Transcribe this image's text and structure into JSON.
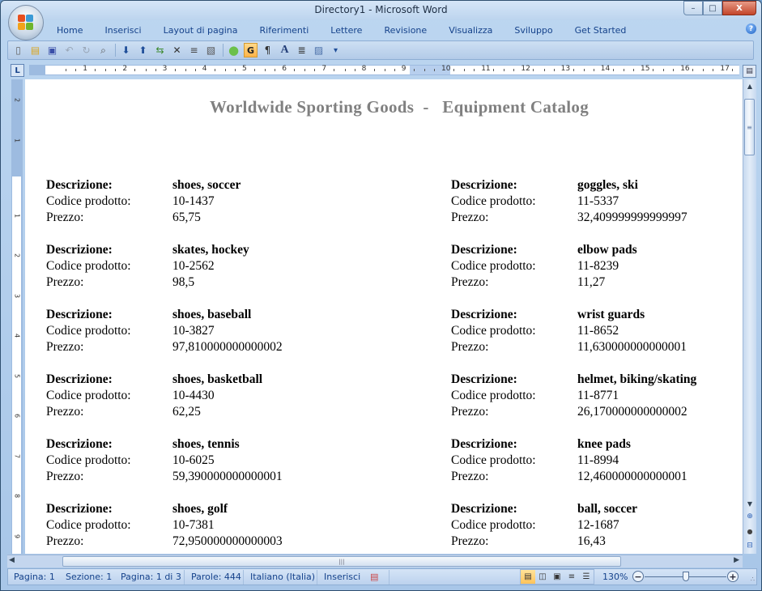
{
  "window": {
    "title": "Directory1 - Microsoft Word",
    "controls": {
      "minimize": "–",
      "maximize": "□",
      "close": "X"
    }
  },
  "ribbon": {
    "tabs": [
      "Home",
      "Inserisci",
      "Layout di pagina",
      "Riferimenti",
      "Lettere",
      "Revisione",
      "Visualizza",
      "Sviluppo",
      "Get Started"
    ],
    "help": "?"
  },
  "toolbar": {
    "items": [
      {
        "icon": "new-document-icon",
        "glyph": "▯"
      },
      {
        "icon": "open-folder-icon",
        "glyph": "▤"
      },
      {
        "icon": "save-icon",
        "glyph": "▣"
      },
      {
        "icon": "undo-icon",
        "glyph": "↶"
      },
      {
        "icon": "redo-icon",
        "glyph": "↻"
      },
      {
        "icon": "print-preview-icon",
        "glyph": "⌕"
      },
      {
        "icon": "move-down-icon",
        "glyph": "⬇"
      },
      {
        "icon": "move-up-icon",
        "glyph": "⬆"
      },
      {
        "icon": "merge-fields-icon",
        "glyph": "⇆"
      },
      {
        "icon": "delete-icon",
        "glyph": "✕"
      },
      {
        "icon": "align-text-icon",
        "glyph": "≡"
      },
      {
        "icon": "document-icon",
        "glyph": "▧"
      },
      {
        "icon": "green-circle-icon",
        "glyph": "●"
      },
      {
        "icon": "g-button-icon",
        "glyph": "G"
      },
      {
        "icon": "pilcrow-icon",
        "glyph": "¶"
      },
      {
        "icon": "font-a-icon",
        "glyph": "A"
      },
      {
        "icon": "paragraph-format-icon",
        "glyph": "≣"
      },
      {
        "icon": "database-icon",
        "glyph": "▨"
      },
      {
        "icon": "customize-toolbar-icon",
        "glyph": "▾"
      }
    ]
  },
  "ruler": {
    "corner": "L",
    "h_numbers": [
      "1",
      "2",
      "3",
      "4",
      "5",
      "6",
      "7",
      "8",
      "9",
      "10",
      "11",
      "12",
      "13",
      "14",
      "15",
      "16",
      "17"
    ],
    "v_numbers_top": [
      "2",
      "1"
    ],
    "v_numbers": [
      "1",
      "2",
      "3",
      "4",
      "5",
      "6",
      "7",
      "8",
      "9"
    ]
  },
  "document": {
    "title": "Worldwide Sporting Goods  -   Equipment Catalog",
    "labels": {
      "description": "Descrizione:",
      "code": "Codice prodotto:",
      "price": "Prezzo:"
    },
    "left_column": [
      {
        "description": "shoes, soccer",
        "code": "10-1437",
        "price": "65,75"
      },
      {
        "description": "skates, hockey",
        "code": "10-2562",
        "price": "98,5"
      },
      {
        "description": "shoes, baseball",
        "code": "10-3827",
        "price": "97,810000000000002"
      },
      {
        "description": "shoes, basketball",
        "code": "10-4430",
        "price": "62,25"
      },
      {
        "description": "shoes, tennis",
        "code": "10-6025",
        "price": "59,390000000000001"
      },
      {
        "description": "shoes, golf",
        "code": "10-7381",
        "price": "72,950000000000003"
      }
    ],
    "right_column": [
      {
        "description": "goggles, ski",
        "code": "11-5337",
        "price": "32,409999999999997"
      },
      {
        "description": "elbow pads",
        "code": "11-8239",
        "price": "11,27"
      },
      {
        "description": "wrist guards",
        "code": "11-8652",
        "price": "11,630000000000001"
      },
      {
        "description": "helmet, biking/skating",
        "code": "11-8771",
        "price": "26,170000000000002"
      },
      {
        "description": "knee pads",
        "code": "11-8994",
        "price": "12,460000000000001"
      },
      {
        "description": "ball, soccer",
        "code": "12-1687",
        "price": "16,43"
      }
    ]
  },
  "statusbar": {
    "page": "Pagina: 1",
    "section": "Sezione: 1",
    "page_of": "Pagina: 1 di 3",
    "words": "Parole: 444",
    "language": "Italiano (Italia)",
    "mode": "Inserisci",
    "zoom": "130%",
    "zoom_minus": "−",
    "zoom_plus": "+",
    "zoom_fraction": 0.5
  }
}
